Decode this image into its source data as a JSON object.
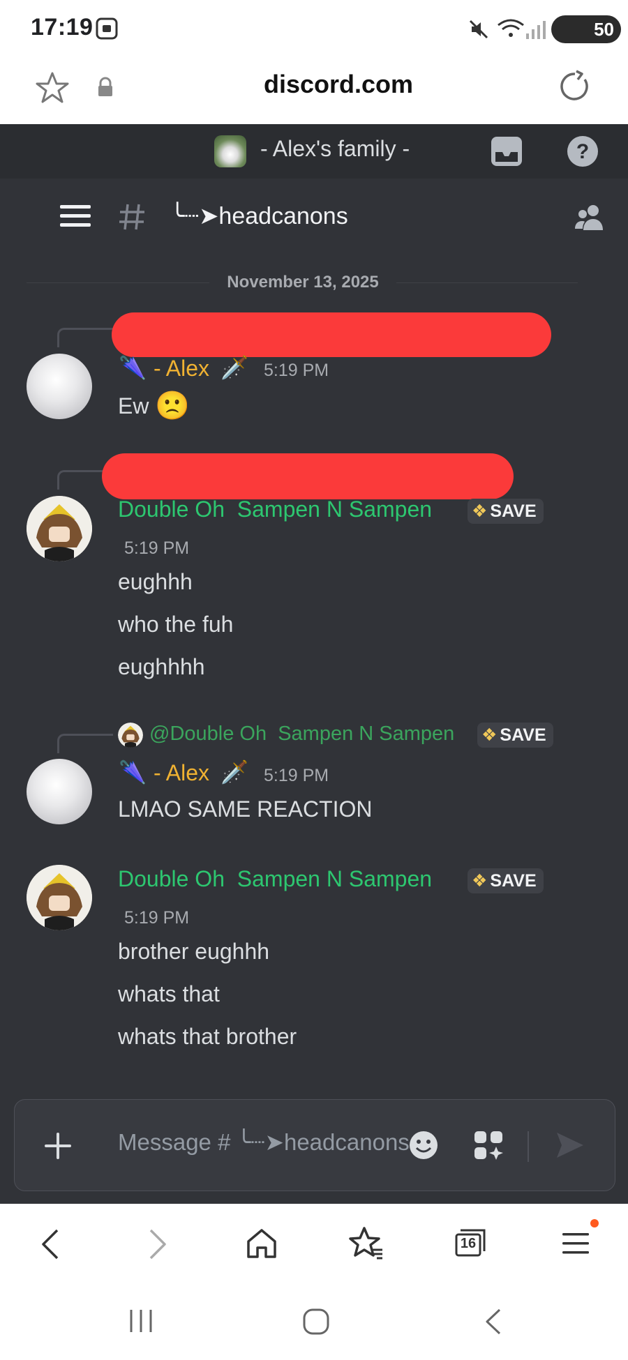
{
  "status_bar": {
    "time": "17:19",
    "battery": "50"
  },
  "browser": {
    "url": "discord.com",
    "tab_count": "16"
  },
  "server": {
    "name": "- Alex's family -"
  },
  "channel": {
    "name": "╰┈➤headcanons"
  },
  "chat": {
    "date_divider": "November 13, 2025",
    "messages": [
      {
        "author": "- Alex",
        "author_prefix_emoji": "🌂",
        "author_suffix_emoji": "🗡️",
        "timestamp": "5:19 PM",
        "lines": [
          "Ew"
        ],
        "trailing_emoji": "🙁"
      },
      {
        "author": "Double Oh  Sampen N Sampen",
        "tag": "SAVE",
        "timestamp": "5:19 PM",
        "lines": [
          "eughhh",
          "who the fuh",
          "eughhhh"
        ]
      },
      {
        "reply_to": "@Double Oh  Sampen N Sampen",
        "reply_tag": "SAVE",
        "author": "- Alex",
        "author_prefix_emoji": "🌂",
        "author_suffix_emoji": "🗡️",
        "timestamp": "5:19 PM",
        "lines": [
          "LMAO SAME REACTION"
        ]
      },
      {
        "author": "Double Oh  Sampen N Sampen",
        "tag": "SAVE",
        "timestamp": "5:19 PM",
        "lines": [
          "brother eughhh",
          "whats that",
          "whats that brother"
        ]
      }
    ]
  },
  "composer": {
    "placeholder": "Message # ╰┈➤headcanons"
  },
  "colors": {
    "discord_bg": "#313338",
    "server_bar": "#2b2d31",
    "alex_name": "#f0b232",
    "sam_name": "#2dc770",
    "redaction": "#fb3a3a"
  },
  "icons": [
    "bookmark-star-icon",
    "lock-icon",
    "reload-icon",
    "inbox-icon",
    "help-icon",
    "hamburger-icon",
    "hash-icon",
    "members-icon",
    "plus-icon",
    "emoji-icon",
    "apps-icon",
    "send-icon",
    "back-icon",
    "forward-icon",
    "home-icon",
    "favorites-icon",
    "tabs-icon",
    "menu-icon"
  ]
}
